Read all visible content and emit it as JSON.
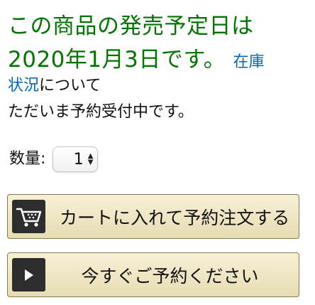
{
  "availability": {
    "line1": "この商品の発売予定日は",
    "line2": "2020年1月3日です。",
    "stock_link_part1": "在庫",
    "stock_link_part2": "状況",
    "stock_suffix": "について"
  },
  "preorder_text": "ただいま予約受付中です。",
  "quantity": {
    "label": "数量:",
    "value": "1"
  },
  "buttons": {
    "cart_label": "カートに入れて予約注文する",
    "buy_now_label": "今すぐご予約ください"
  },
  "icons": {
    "cart": "cart-icon",
    "play": "play-icon",
    "arrows": "updown-arrows-icon"
  },
  "colors": {
    "availability_green": "#007600",
    "link_blue": "#0066c0",
    "button_gold": "#e6dcb3",
    "icon_dark": "#2d2d2d"
  }
}
